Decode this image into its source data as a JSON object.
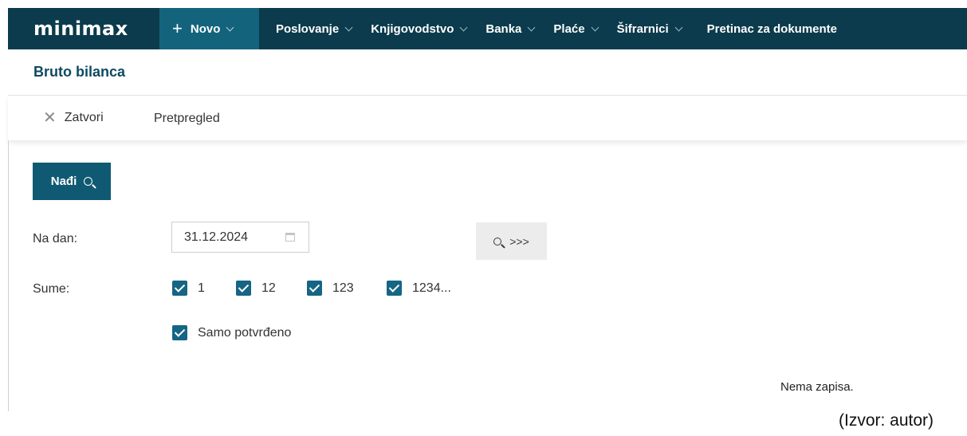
{
  "app": {
    "logo": "minimax"
  },
  "nav": {
    "novo_label": "Novo",
    "items": [
      {
        "label": "Poslovanje"
      },
      {
        "label": "Knjigovodstvo"
      },
      {
        "label": "Banka"
      },
      {
        "label": "Plaće"
      },
      {
        "label": "Šifrarnici"
      },
      {
        "label": "Pretinac za dokumente"
      }
    ]
  },
  "page": {
    "title": "Bruto bilanca"
  },
  "toolbar": {
    "close_label": "Zatvori",
    "preview_label": "Pretpregled"
  },
  "form": {
    "find_label": "Nađi",
    "date_label": "Na dan:",
    "date_value": "31.12.2024",
    "search_more_label": ">>>",
    "sums_label": "Sume:",
    "sums": [
      {
        "label": "1",
        "checked": true
      },
      {
        "label": "12",
        "checked": true
      },
      {
        "label": "123",
        "checked": true
      },
      {
        "label": "1234...",
        "checked": true
      }
    ],
    "confirmed_only_label": "Samo potvrđeno",
    "confirmed_only_checked": true
  },
  "results": {
    "empty_text": "Nema zapisa."
  },
  "caption": "(Izvor: autor)",
  "colors": {
    "nav_bg": "#0b3b4c",
    "nav_active_bg": "#13637d",
    "primary_button": "#0f5a72",
    "checkbox": "#156584",
    "title": "#0e4a61"
  }
}
